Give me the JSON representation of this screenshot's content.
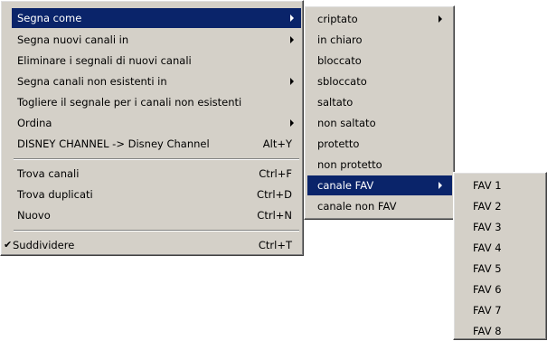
{
  "main_menu": {
    "items": [
      {
        "label": "Segna come",
        "submenu": true,
        "highlighted": true
      },
      {
        "label": "Segna nuovi canali in",
        "submenu": true
      },
      {
        "label": "Eliminare i segnali di nuovi canali"
      },
      {
        "label": "Segna canali non esistenti in",
        "submenu": true
      },
      {
        "label": "Togliere il segnale per i canali non esistenti"
      },
      {
        "label": "Ordina",
        "submenu": true
      },
      {
        "label": "DISNEY CHANNEL -> Disney Channel",
        "shortcut": "Alt+Y"
      },
      {
        "label": "Trova canali",
        "shortcut": "Ctrl+F"
      },
      {
        "label": "Trova duplicati",
        "shortcut": "Ctrl+D"
      },
      {
        "label": "Nuovo",
        "shortcut": "Ctrl+N"
      },
      {
        "label": "Suddividere",
        "shortcut": "Ctrl+T",
        "checked": true,
        "check_glyph": "✔"
      }
    ]
  },
  "segna_come_submenu": {
    "items": [
      {
        "label": "criptato",
        "submenu": true
      },
      {
        "label": "in chiaro"
      },
      {
        "label": "bloccato"
      },
      {
        "label": "sbloccato"
      },
      {
        "label": "saltato"
      },
      {
        "label": "non saltato"
      },
      {
        "label": "protetto"
      },
      {
        "label": "non protetto"
      },
      {
        "label": "canale FAV",
        "submenu": true,
        "highlighted": true
      },
      {
        "label": "canale non FAV"
      }
    ]
  },
  "fav_submenu": {
    "items": [
      "FAV 1",
      "FAV 2",
      "FAV 3",
      "FAV 4",
      "FAV 5",
      "FAV 6",
      "FAV 7",
      "FAV 8"
    ]
  },
  "colors": {
    "menu_bg": "#d4d0c8",
    "highlight": "#0a246a",
    "highlight_text": "#ffffff"
  },
  "icons": {
    "submenu_arrow": "chevron-right-icon",
    "check": "checkmark-icon"
  }
}
